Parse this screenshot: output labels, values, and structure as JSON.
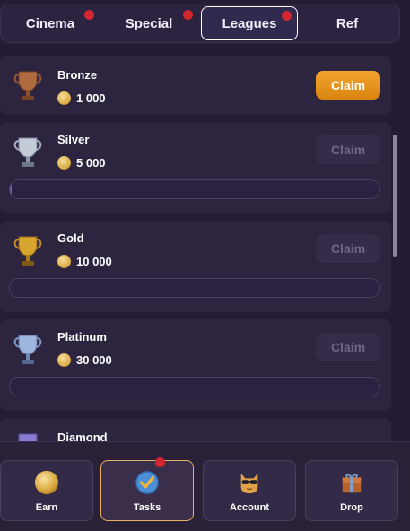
{
  "tabs": [
    {
      "label": "Cinema",
      "badge": true,
      "active": false
    },
    {
      "label": "Special",
      "badge": true,
      "active": false
    },
    {
      "label": "Leagues",
      "badge": true,
      "active": true
    },
    {
      "label": "Ref",
      "badge": false,
      "active": false
    }
  ],
  "leagues": [
    {
      "name": "Bronze",
      "reward": "1 000",
      "claim_label": "Claim",
      "claim_enabled": true,
      "trophy_icon": "bronze-trophy-icon",
      "color": "#b06a3f"
    },
    {
      "name": "Silver",
      "reward": "5 000",
      "claim_label": "Claim",
      "claim_enabled": false,
      "trophy_icon": "silver-trophy-icon",
      "color": "#c4ccd8",
      "progress": 0.01
    },
    {
      "name": "Gold",
      "reward": "10 000",
      "claim_label": "Claim",
      "claim_enabled": false,
      "trophy_icon": "gold-trophy-icon",
      "color": "#d9a531",
      "progress": 0
    },
    {
      "name": "Platinum",
      "reward": "30 000",
      "claim_label": "Claim",
      "claim_enabled": false,
      "trophy_icon": "platinum-trophy-icon",
      "color": "#9fb6e0",
      "progress": 0
    },
    {
      "name": "Diamond",
      "trophy_icon": "diamond-trophy-icon",
      "color": "#8a7ad0"
    }
  ],
  "bottom_nav": [
    {
      "label": "Earn",
      "icon": "coin-icon",
      "active": false,
      "badge": false
    },
    {
      "label": "Tasks",
      "icon": "tasks-check-icon",
      "active": true,
      "badge": true
    },
    {
      "label": "Account",
      "icon": "cat-sunglasses-icon",
      "active": false,
      "badge": false
    },
    {
      "label": "Drop",
      "icon": "gift-box-icon",
      "active": false,
      "badge": false
    }
  ],
  "colors": {
    "background": "#241b35",
    "card": "#2d2540",
    "accent": "#e5961d",
    "badge": "#d2272f"
  }
}
